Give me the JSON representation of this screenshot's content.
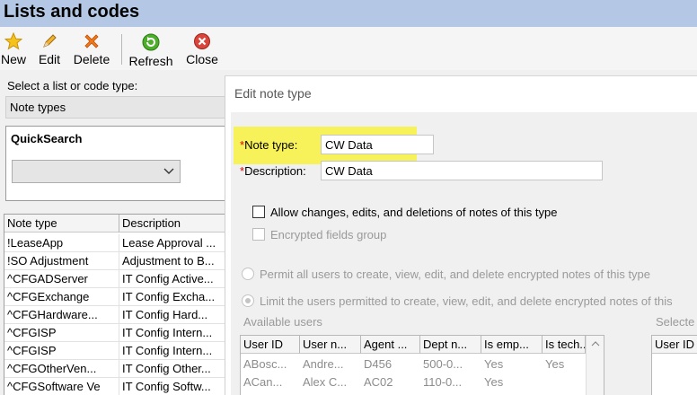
{
  "window": {
    "title": "Lists and codes"
  },
  "toolbar": {
    "buttons": [
      {
        "label": "New",
        "icon": "star-icon"
      },
      {
        "label": "Edit",
        "icon": "pencil-icon"
      },
      {
        "label": "Delete",
        "icon": "red-x-icon"
      },
      {
        "label": "Refresh",
        "icon": "green-refresh-icon"
      },
      {
        "label": "Close",
        "icon": "red-close-circle-icon"
      }
    ]
  },
  "selector": {
    "label": "Select a list or code type:",
    "value": "Note types"
  },
  "quicksearch": {
    "title": "QuickSearch",
    "value": ""
  },
  "grid": {
    "columns": [
      "Note type",
      "Description"
    ],
    "rows": [
      [
        "!LeaseApp",
        "Lease Approval ..."
      ],
      [
        "!SO Adjustment",
        "Adjustment to B..."
      ],
      [
        "^CFGADServer",
        "IT Config Active..."
      ],
      [
        "^CFGExchange",
        "IT Config Excha..."
      ],
      [
        "^CFGHardware...",
        "IT Config Hard..."
      ],
      [
        "^CFGISP",
        "IT Config Intern..."
      ],
      [
        "^CFGISP",
        "IT Config Intern..."
      ],
      [
        "^CFGOtherVen...",
        "IT Config Other..."
      ],
      [
        "^CFGSoftware Ve",
        "IT Config Softw..."
      ]
    ]
  },
  "dialog": {
    "title": "Edit note type",
    "note_type": {
      "label": "Note type:",
      "required_mark": "*",
      "value": "CW Data"
    },
    "description": {
      "label": "Description:",
      "required_mark": "*",
      "value": "CW Data"
    },
    "allow_changes": {
      "label": "Allow changes, edits, and deletions of notes of this type",
      "checked": false
    },
    "encrypted_group": {
      "label": "Encrypted fields group",
      "checked": false
    },
    "permit_all": {
      "label": "Permit all users to create, view, edit, and delete encrypted notes of this type",
      "selected": false
    },
    "limit_users": {
      "label": "Limit the users permitted to create, view, edit, and delete encrypted notes of this",
      "selected": true
    },
    "available_users": {
      "label": "Available users",
      "columns": [
        "User ID",
        "User n...",
        "Agent ...",
        "Dept n...",
        "Is emp...",
        "Is tech..."
      ],
      "rows": [
        [
          "ABosc...",
          "Andre...",
          "D456",
          "500-0...",
          "Yes",
          "Yes"
        ],
        [
          "ACan...",
          "Alex C...",
          "AC02",
          "110-0...",
          "Yes",
          ""
        ]
      ]
    },
    "selected_users": {
      "label": "Selecte",
      "columns": [
        "User ID"
      ]
    }
  },
  "colors": {
    "title_bar": "#b4c8e6",
    "highlight": "#f7f25a",
    "required": "#e00000"
  }
}
